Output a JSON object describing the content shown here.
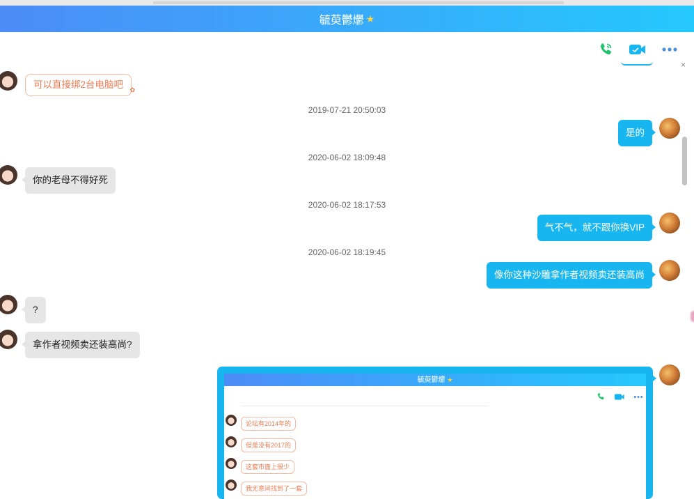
{
  "header": {
    "title": "毓萸鬱爩"
  },
  "toolbar": {
    "icons": [
      "phone-icon",
      "video-icon",
      "more-icon"
    ]
  },
  "messages": [
    {
      "id": "m1",
      "side": "left",
      "style": "fancy",
      "text": "可以直接绑2台电脑吧"
    },
    {
      "id": "t1",
      "type": "timestamp",
      "text": "2019-07-21 20:50:03"
    },
    {
      "id": "m2",
      "side": "right",
      "text": "是的"
    },
    {
      "id": "t2",
      "type": "timestamp",
      "text": "2020-06-02 18:09:48"
    },
    {
      "id": "m3",
      "side": "left",
      "text": "你的老母不得好死"
    },
    {
      "id": "t3",
      "type": "timestamp",
      "text": "2020-06-02 18:17:53"
    },
    {
      "id": "m4",
      "side": "right",
      "text": "气不气，就不跟你换VIP"
    },
    {
      "id": "t4",
      "type": "timestamp",
      "text": "2020-06-02 18:19:45"
    },
    {
      "id": "m5",
      "side": "right",
      "text": "像你这种沙雕拿作者视频卖还装高尚"
    },
    {
      "id": "m6",
      "side": "left",
      "text": "?"
    },
    {
      "id": "m7",
      "side": "left",
      "text": "拿作者视频卖还装高尚?"
    }
  ],
  "screenshot": {
    "title": "毓萸鬱爩",
    "messages": [
      "论坛有2014年的",
      "但是没有2017的",
      "这套市面上很少",
      "我无意间找到了一套"
    ]
  },
  "colors": {
    "accent": "#18b6f0",
    "header_start": "#4c8cf7",
    "header_end": "#25c8ff",
    "fancy_text": "#f07a52"
  }
}
